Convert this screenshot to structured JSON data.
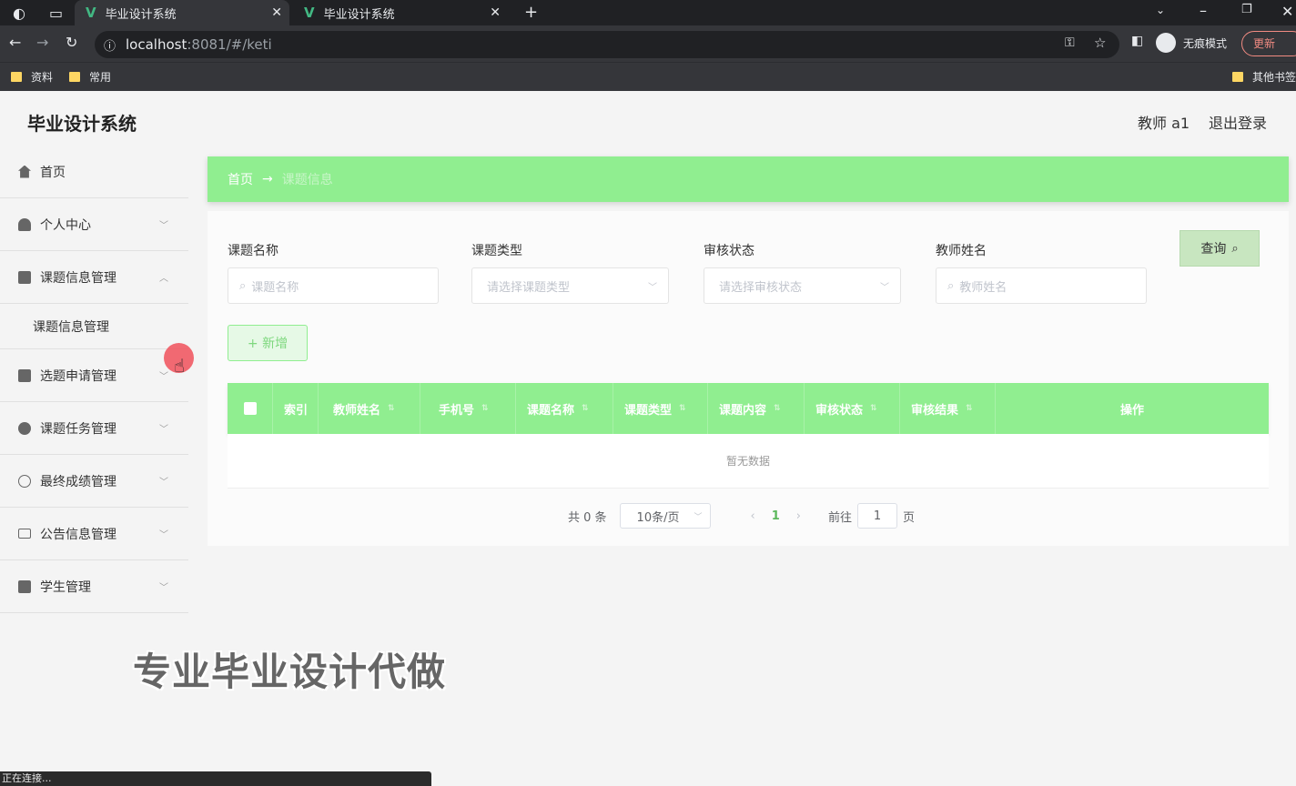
{
  "browser": {
    "tabs": [
      {
        "title": "毕业设计系统",
        "active": true
      },
      {
        "title": "毕业设计系统",
        "active": false
      }
    ],
    "url_host": "localhost",
    "url_rest": ":8081/#/keti",
    "profile_label": "无痕模式",
    "update_label": "更新",
    "bookmarks": [
      "资料",
      "常用"
    ],
    "other_bookmarks": "其他书签",
    "status_text": "正在连接..."
  },
  "header": {
    "app_title": "毕业设计系统",
    "user_label": "教师 a1",
    "logout_label": "退出登录"
  },
  "sidebar": {
    "items": [
      {
        "label": "首页",
        "icon": "home-icon"
      },
      {
        "label": "个人中心",
        "icon": "user-icon"
      },
      {
        "label": "课题信息管理",
        "icon": "monitor-icon"
      },
      {
        "label": "选题申请管理",
        "icon": "clipboard-icon"
      },
      {
        "label": "课题任务管理",
        "icon": "pin-icon"
      },
      {
        "label": "最终成绩管理",
        "icon": "globe-icon"
      },
      {
        "label": "公告信息管理",
        "icon": "mail-icon"
      },
      {
        "label": "学生管理",
        "icon": "chart-icon"
      }
    ],
    "submenu_label": "课题信息管理"
  },
  "breadcrumb": {
    "home": "首页",
    "separator": "→",
    "current": "课题信息"
  },
  "filters": [
    {
      "label": "课题名称",
      "placeholder": "课题名称",
      "type": "input"
    },
    {
      "label": "课题类型",
      "placeholder": "请选择课题类型",
      "type": "select"
    },
    {
      "label": "审核状态",
      "placeholder": "请选择审核状态",
      "type": "select"
    },
    {
      "label": "教师姓名",
      "placeholder": "教师姓名",
      "type": "input"
    }
  ],
  "actions": {
    "query_label": "查询",
    "add_label": "+ 新增"
  },
  "table": {
    "columns": [
      "索引",
      "教师姓名",
      "手机号",
      "课题名称",
      "课题类型",
      "课题内容",
      "审核状态",
      "审核结果",
      "操作"
    ],
    "empty_text": "暂无数据"
  },
  "pagination": {
    "total": "共 0 条",
    "page_size": "10条/页",
    "current_page": "1",
    "goto_label": "前往",
    "goto_value": "1",
    "page_suffix": "页"
  },
  "watermark": "专业毕业设计代做",
  "colors": {
    "accent": "#90ee90",
    "accent_dark": "#5cb85c"
  }
}
